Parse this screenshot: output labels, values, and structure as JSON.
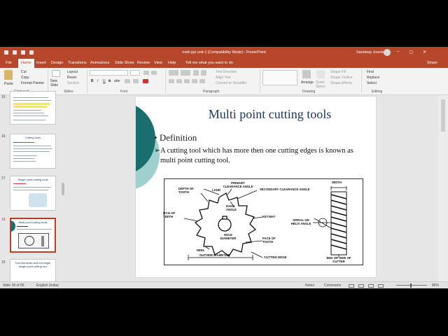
{
  "window": {
    "title": "mett ppt unit-1 [Compatibility Mode] - PowerPoint",
    "user": "Sandeep Jounts",
    "buttons": [
      "–",
      "▢",
      "✕"
    ]
  },
  "tabs": {
    "items": [
      "File",
      "Home",
      "Insert",
      "Design",
      "Transitions",
      "Animations",
      "Slide Show",
      "Review",
      "View",
      "Help"
    ],
    "active": "Home",
    "tell_me": "Tell me what you want to do",
    "share": "Share"
  },
  "ribbon": {
    "clipboard": {
      "paste": "Paste",
      "cut": "Cut",
      "copy": "Copy",
      "format_painter": "Format Painter",
      "label": "Clipboard"
    },
    "slides": {
      "new_slide": "New Slide",
      "layout": "Layout",
      "reset": "Reset",
      "section": "Section",
      "label": "Slides"
    },
    "font": {
      "label": "Font",
      "bold": "B",
      "italic": "I",
      "underline": "U",
      "strike": "S",
      "shadow": "abe"
    },
    "paragraph": {
      "label": "Paragraph",
      "text_direction": "Text Direction",
      "align_text": "Align Text",
      "convert_smartart": "Convert to SmartArt"
    },
    "drawing": {
      "label": "Drawing",
      "arrange": "Arrange",
      "quick_styles": "Quick Styles",
      "shape_fill": "Shape Fill",
      "shape_outline": "Shape Outline",
      "shape_effects": "Shape Effects"
    },
    "editing": {
      "label": "Editing",
      "find": "Find",
      "replace": "Replace",
      "select": "Select"
    }
  },
  "thumbnails": [
    {
      "number": "15",
      "title": ""
    },
    {
      "number": "16",
      "title": "Cutting tools"
    },
    {
      "number": "17",
      "title": "Single point cutting tools"
    },
    {
      "number": "18",
      "title": "Multi point cutting tools"
    },
    {
      "number": "19",
      "title": "Tool elements and tool angle single point cutting tool"
    }
  ],
  "slide": {
    "title": "Multi point cutting tools",
    "bullet": "Definition",
    "definition": "A cutting tool which has more then one cutting edges is known as multi point cutting tool.",
    "diagram_labels": {
      "depth_of_tooth": "DEPTH OF TOOTH",
      "land": "LAND",
      "primary_clearance": "PRIMARY CLEARANCE ANGLE",
      "secondary_clearance": "SECONDARY CLEARANCE ANGLE",
      "rake_angle": "RAKE ANGLE",
      "pitch_of_teeth": "ITCH OF TEETH",
      "keyway": "KEYWAY",
      "hole_diameter": "HOLE DIAMETER",
      "face_of_tooth": "FACE OF TOOTH",
      "heel": "HEEL",
      "outside_diameter": "OUTSIDE DIAMETER",
      "cutting_edge": "CUTTING EDGE",
      "width": "WIDTH",
      "spiral_helix": "SPIRAL OR HELIX ANGLE",
      "end_or_side": "END OR SIDE OF CUTTER"
    }
  },
  "status": {
    "slide_info": "Slide 18 of 65",
    "language": "English (India)",
    "notes": "Notes",
    "comments": "Comments",
    "zoom": "86%"
  },
  "colors": {
    "accent": "#b7472a",
    "title_blue": "#1f3864",
    "teal_dark": "#1a6e6e",
    "teal_light": "#9fcfcf"
  }
}
